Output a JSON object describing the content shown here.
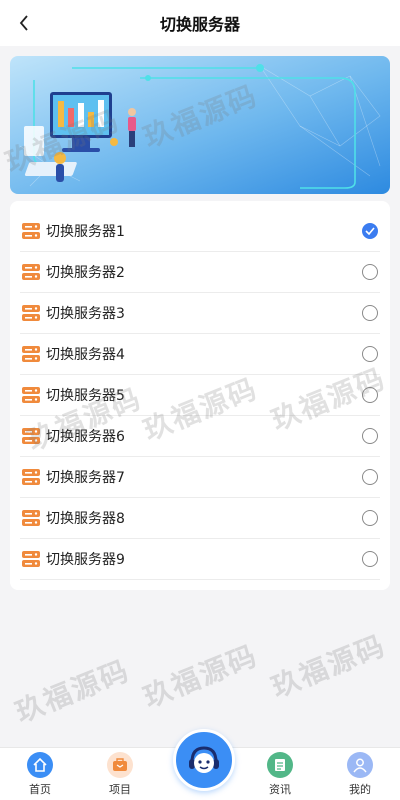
{
  "header": {
    "title": "切换服务器"
  },
  "servers": [
    {
      "label": "切换服务器1",
      "selected": true
    },
    {
      "label": "切换服务器2",
      "selected": false
    },
    {
      "label": "切换服务器3",
      "selected": false
    },
    {
      "label": "切换服务器4",
      "selected": false
    },
    {
      "label": "切换服务器5",
      "selected": false
    },
    {
      "label": "切换服务器6",
      "selected": false
    },
    {
      "label": "切换服务器7",
      "selected": false
    },
    {
      "label": "切换服务器8",
      "selected": false
    },
    {
      "label": "切换服务器9",
      "selected": false
    }
  ],
  "watermark": "玖福源码",
  "tabbar": {
    "items": [
      {
        "label": "首页",
        "icon": "home-icon"
      },
      {
        "label": "项目",
        "icon": "briefcase-icon"
      },
      {
        "label": "资讯",
        "icon": "news-icon"
      },
      {
        "label": "我的",
        "icon": "user-icon"
      }
    ],
    "center_icon": "customer-service-icon"
  },
  "colors": {
    "accent": "#3b7cf0",
    "server_icon": "#f08a3c",
    "background": "#f4f4f6"
  }
}
